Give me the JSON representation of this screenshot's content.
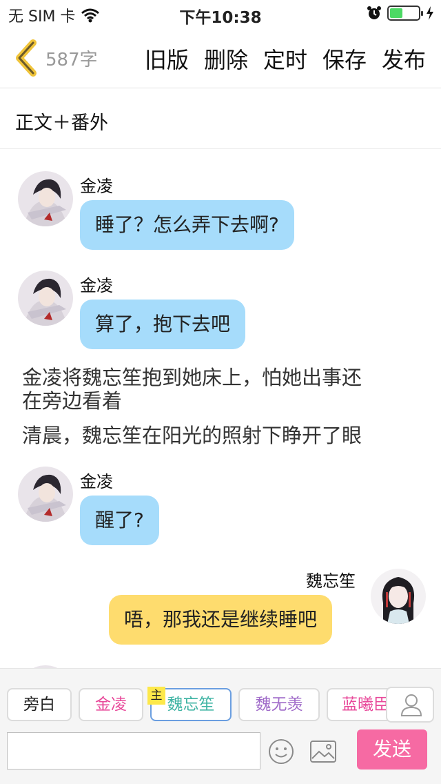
{
  "status_bar": {
    "carrier": "无 SIM 卡",
    "time": "下午10:38",
    "battery_level": 0.45,
    "battery_color": "#4cd964"
  },
  "nav": {
    "back_icon": "chevron-left-icon",
    "word_count": "587字",
    "actions": [
      "旧版",
      "删除",
      "定时",
      "保存",
      "发布"
    ]
  },
  "chapter": {
    "title": "正文＋番外"
  },
  "messages": [
    {
      "type": "bubble",
      "side": "left",
      "speaker": "金凌",
      "text": "睡了？怎么弄下去啊?",
      "color": "#a6dcfb"
    },
    {
      "type": "bubble",
      "side": "left",
      "speaker": "金凌",
      "text": "算了，抱下去吧",
      "color": "#a6dcfb"
    },
    {
      "type": "narration",
      "line1": "金凌将魏忘笙抱到她床上，怕她出事还",
      "line2": "在旁边看着"
    },
    {
      "type": "narration",
      "text": "清晨，魏忘笙在阳光的照射下睁开了眼"
    },
    {
      "type": "bubble",
      "side": "left",
      "speaker": "金凌",
      "text": "醒了?",
      "color": "#a6dcfb"
    },
    {
      "type": "bubble",
      "side": "right",
      "speaker": "魏忘笙",
      "text": "唔，那我还是继续睡吧",
      "color": "#fedc6e"
    }
  ],
  "roles": {
    "tabs": [
      {
        "label": "旁白",
        "color": "#222222"
      },
      {
        "label": "金凌",
        "color": "#e8499a"
      },
      {
        "label": "魏忘笙",
        "color": "#3fb4a4"
      },
      {
        "label": "魏无羡",
        "color": "#a06bc9"
      },
      {
        "label": "蓝曦臣",
        "color": "#e8499a"
      }
    ],
    "main_badge": "主",
    "active_index": 2,
    "add_icon": "user-icon"
  },
  "composer": {
    "input_value": "",
    "input_placeholder": "",
    "emoji_icon": "smiley-icon",
    "image_icon": "image-icon",
    "send_label": "发送",
    "send_color": "#f66aa3"
  }
}
